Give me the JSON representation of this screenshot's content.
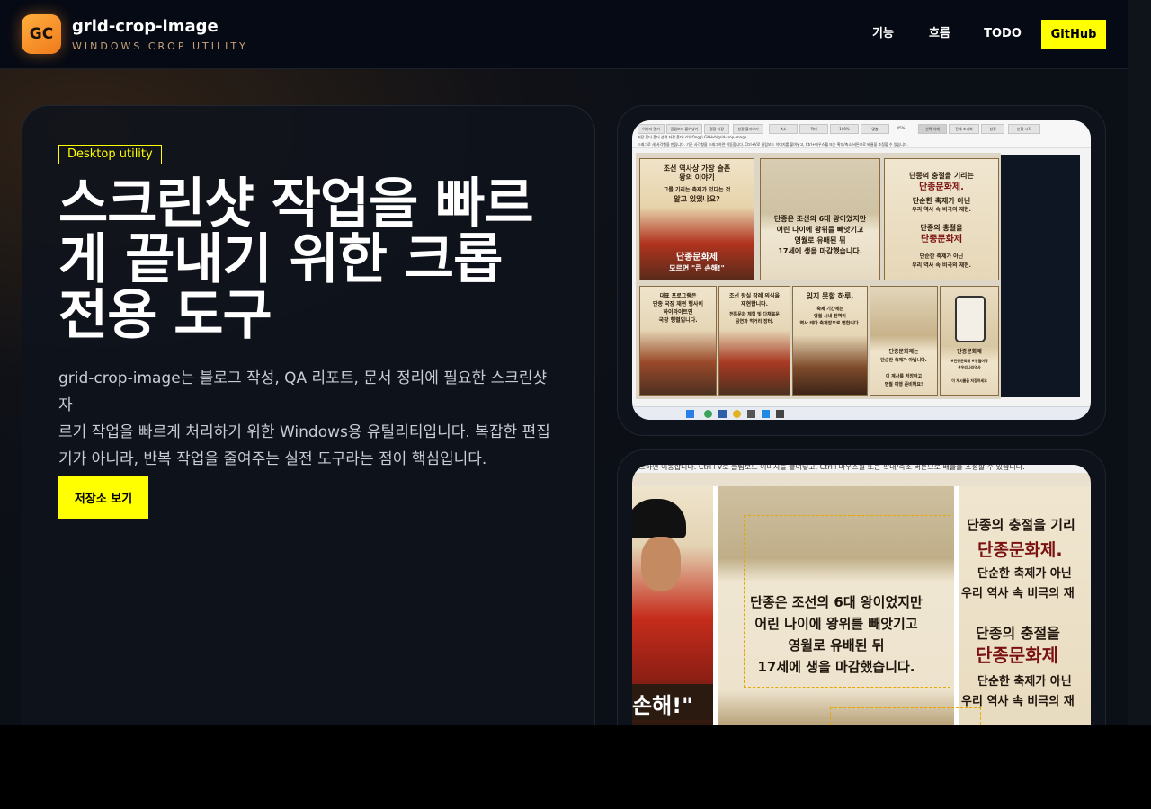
{
  "header": {
    "logo_initials": "GC",
    "brand_name": "grid-crop-image",
    "brand_sub": "WINDOWS CROP UTILITY",
    "nav": [
      {
        "label": "기능"
      },
      {
        "label": "흐름"
      },
      {
        "label": "TODO"
      }
    ],
    "github_label": "GitHub"
  },
  "hero": {
    "tag": "Desktop utility",
    "title_lines": [
      "스크린샷 작업을 빠르",
      "게 끝내기 위한 크롭",
      "전용 도구"
    ],
    "desc_lines": [
      "grid-crop-image는 블로그 작성, QA 리포트, 문서 정리에 필요한 스크린샷 자",
      "르기 작업을 빠르게 처리하기 위한 Windows용 유틸리티입니다. 복잡한 편집",
      "기가 아니라, 반복 작업을 줄여주는 실전 도구라는 점이 핵심입니다."
    ],
    "cta_label": "저장소 보기"
  },
  "screenshot1": {
    "toolbar_buttons": [
      "이미지 열기",
      "클립보드 붙여넣기",
      "결합 저장",
      "설정 불러오기",
      "축소",
      "확대",
      "100%",
      "맞춤",
      "45%",
      "선택 삭제",
      "전체 초기화",
      "설정",
      "분할 시작"
    ],
    "path_line": "저장 폴더   폴더 선택   저장 폴더: d:\\kOngg\\ GitHub\\grid-crop-image",
    "hint_line": "드래그로 새 사각형을 만듭니다. 기존 사각형을 드래그하면 이동합니다. Ctrl+V로 클립보드 이미지를 붙여넣고, Ctrl+마우스휠 또는 확대/축소 버튼으로 배율을 조정할 수 있습니다.",
    "tiles_top": [
      [
        "조선 역사상 가장 슬픈",
        "왕의 이야기",
        "그를 기리는 축제가 있다는 것",
        "알고 있었나요?",
        "단종문화제",
        "모르면 \"큰 손해!\""
      ],
      [
        "단종은 조선의 6대 왕이었지만",
        "어린 나이에 왕위를 빼앗기고",
        "영월로 유배된 뒤",
        "17세에 생을 마감했습니다."
      ],
      [
        "단종의 충절을 기리는",
        "단종문화제.",
        "단순한 축제가 아닌",
        "우리 역사 속 비극의 재현.",
        "단종의 충절을",
        "단종문화제",
        "단순한 축제가 아닌",
        "우리 역사 속 비극의 재현."
      ]
    ],
    "tiles_bottom": [
      [
        "대표 프로그램은",
        "단종 국장 재현 행사이",
        "하이라이트인",
        "국장 행렬입니다."
      ],
      [
        "조선 왕실 장례 의식을",
        "재현합니다.",
        "전통문화 체험 및 다채로운",
        "공연과 먹거리 장터."
      ],
      [
        "잊지 못할 하루,",
        "축제 기간에는",
        "영월 시내 전역이",
        "역사 테마 축제장으로 변합니다."
      ],
      [
        "단종문화제는",
        "단순한 축제가 아닙니다.",
        "이 계사를 저장하고",
        "영월 여행 준비해요!"
      ],
      [
        "단종문화제",
        "#단종문화제 #영월여행",
        "#우리나라역사",
        "이 게시물을 저장하세요"
      ]
    ]
  },
  "screenshot2": {
    "top_hint": "태그하면 이동합니다. Ctrl+V로 클립보드 이미지를 붙여넣고, Ctrl+마우스휠 또는 확대/축소 버튼으로 배율을 조정할 수 있습니다.",
    "left_caption": "손해!\"",
    "center_lines": [
      "단종은 조선의 6대 왕이었지만",
      "어린 나이에 왕위를 빼앗기고",
      "영월로 유배된 뒤",
      "17세에 생을 마감했습니다."
    ],
    "right_lines": [
      "단종의 충절을 기리",
      "단종문화제.",
      "단순한 축제가 아닌",
      "우리 역사 속 비극의 재",
      "단종의 충절을",
      "단종문화제",
      "단순한 축제가 아닌",
      "우리 역사 속 비극의 재"
    ]
  },
  "colors": {
    "accent_yellow": "#ffff00",
    "logo_orange": "#f7921e",
    "bg": "#0b0f16"
  }
}
